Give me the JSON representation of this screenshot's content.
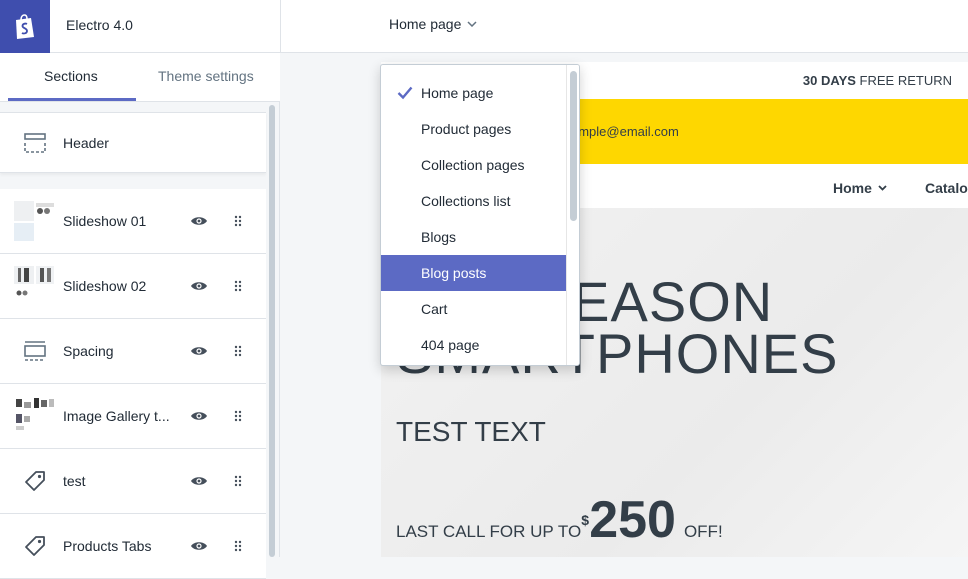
{
  "app": {
    "theme_name": "Electro 4.0",
    "page_selector": "Home page"
  },
  "tabs": [
    {
      "label": "Sections",
      "active": true
    },
    {
      "label": "Theme settings",
      "active": false
    }
  ],
  "sections": {
    "header": "Header",
    "items": [
      {
        "label": "Slideshow 01",
        "icon": "slideshow-thumbnail"
      },
      {
        "label": "Slideshow 02",
        "icon": "slideshow-thumbnail"
      },
      {
        "label": "Spacing",
        "icon": "spacing-icon"
      },
      {
        "label": "Image Gallery t...",
        "icon": "gallery-thumbnail"
      },
      {
        "label": "test",
        "icon": "tag-icon"
      },
      {
        "label": "Products Tabs",
        "icon": "tag-icon"
      }
    ]
  },
  "dropdown": {
    "options": [
      {
        "label": "Home page",
        "checked": true
      },
      {
        "label": "Product pages"
      },
      {
        "label": "Collection pages"
      },
      {
        "label": "Collections list"
      },
      {
        "label": "Blogs"
      },
      {
        "label": "Blog posts",
        "highlighted": true
      },
      {
        "label": "Cart"
      },
      {
        "label": "404 page"
      }
    ]
  },
  "preview": {
    "free_return_bold": "30 DAYS",
    "free_return_rest": "FREE RETURN",
    "email": "ample@email.com",
    "nav_home": "Home",
    "nav_catalog": "Catalo",
    "hero_line1": "END SEASON",
    "hero_line2": "SMARTPHONES",
    "hero_sub": "TEST TEXT",
    "offer_prefix": "LAST CALL FOR UP TO",
    "currency": "$",
    "price": "250",
    "offer_suffix": "OFF!"
  },
  "colors": {
    "accent": "#5c6ac4",
    "logo_bg": "#3f4eae",
    "promo_yellow": "#fed700"
  }
}
